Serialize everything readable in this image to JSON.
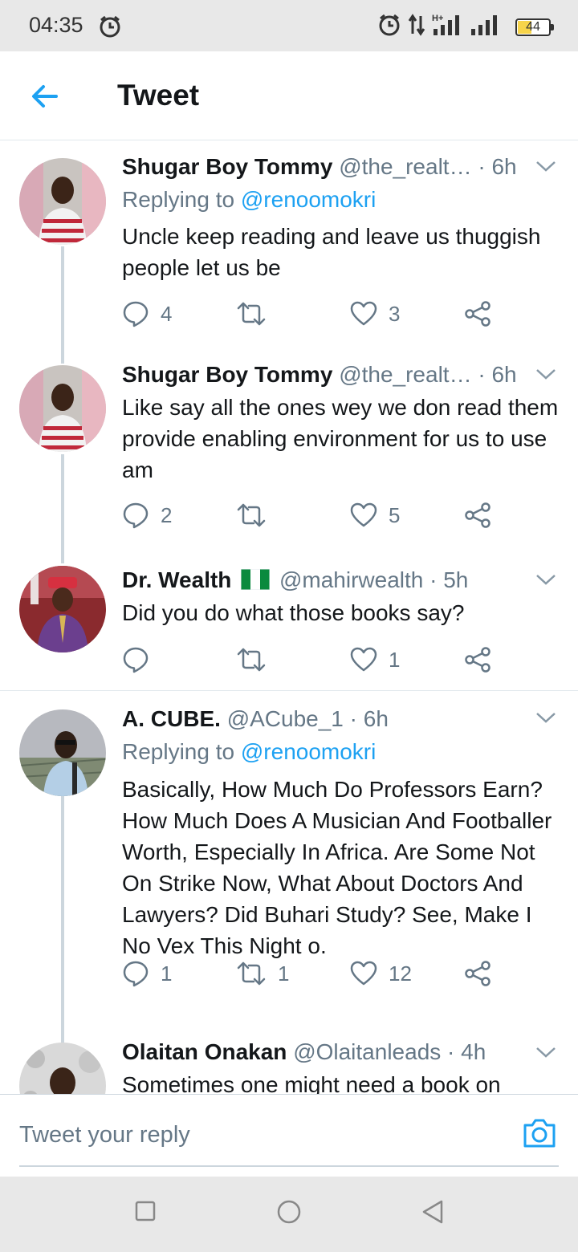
{
  "status_bar": {
    "time": "04:35",
    "battery_level": "44",
    "icons": [
      "alarm-icon",
      "alarm-icon",
      "data-transfer-icon",
      "signal-h-plus-icon",
      "signal-icon",
      "battery-icon"
    ]
  },
  "header": {
    "title": "Tweet",
    "accent_color": "#1da1f2"
  },
  "tweets": [
    {
      "name": "Shugar Boy Tommy",
      "handle": "@the_realt…",
      "time": "· 6h",
      "replying_label": "Replying to",
      "replying_to": "@renoomokri",
      "text": "Uncle keep reading and leave us thuggish people let us be",
      "replies": "4",
      "retweets": "",
      "likes": "3"
    },
    {
      "name": "Shugar Boy Tommy",
      "handle": "@the_realt…",
      "time": "· 6h",
      "text": "Like say all the ones wey we don read them provide enabling environment for us to use am",
      "replies": "2",
      "retweets": "",
      "likes": "5"
    },
    {
      "name": "Dr. Wealth",
      "flag": "nigeria-flag-icon",
      "handle": "@mahirwealth",
      "time": "· 5h",
      "text": "Did you do what those books say?",
      "replies": "",
      "retweets": "",
      "likes": "1"
    },
    {
      "name": "A. CUBE.",
      "handle": "@ACube_1",
      "time": "· 6h",
      "replying_label": "Replying to",
      "replying_to": "@renoomokri",
      "text": "Basically, How Much Do Professors Earn? How Much Does A Musician And Footballer Worth, Especially In Africa. Are Some Not On Strike Now, What About Doctors And Lawyers? Did Buhari Study? See, Make I No Vex This Night o.",
      "replies": "1",
      "retweets": "1",
      "likes": "12"
    },
    {
      "name": "Olaitan Onakan",
      "handle": "@Olaitanleads",
      "time": "· 4h",
      "text": "Sometimes one might need a book on"
    }
  ],
  "compose": {
    "placeholder": "Tweet your reply"
  },
  "nav_bar": {
    "buttons": [
      "square-recents-icon",
      "circle-home-icon",
      "triangle-back-icon"
    ]
  }
}
